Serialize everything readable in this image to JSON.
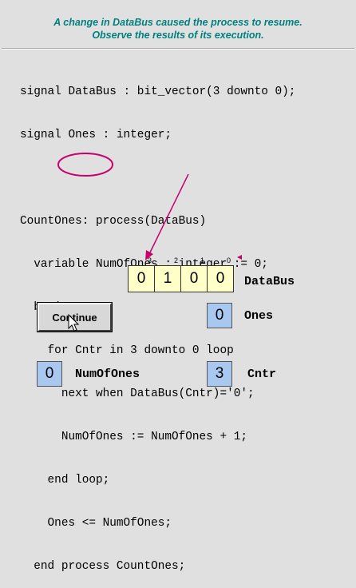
{
  "header": {
    "line1": "A change in DataBus caused the process to resume.",
    "line2": "Observe the results of its execution."
  },
  "code_lines": [
    "signal DataBus : bit_vector(3 downto 0);",
    "signal Ones : integer;",
    "",
    "CountOnes: process(DataBus)",
    "  variable NumOfOnes : integer := 0;",
    "  begin",
    "    for Cntr in 3 downto 0 loop",
    "      next when DataBus(Cntr)='0';",
    "      NumOfOnes := NumOfOnes + 1;",
    "    end loop;",
    "    Ones <= NumOfOnes;",
    "  end process CountOnes;"
  ],
  "databus": {
    "label": "DataBus",
    "indices": [
      "3",
      "2",
      "1",
      "0"
    ],
    "bits": [
      "0",
      "1",
      "0",
      "0"
    ]
  },
  "ones": {
    "label": "Ones",
    "value": "0"
  },
  "numofones": {
    "label": "NumOfOnes",
    "value": "0"
  },
  "cntr": {
    "label": "Cntr",
    "value": "3"
  },
  "controls": {
    "continue_label": "Continue"
  },
  "colors": {
    "caption": "#00807f",
    "highlight": "#c8006e",
    "bit_fill": "#ffffc8",
    "value_fill": "#a8c8f0"
  }
}
